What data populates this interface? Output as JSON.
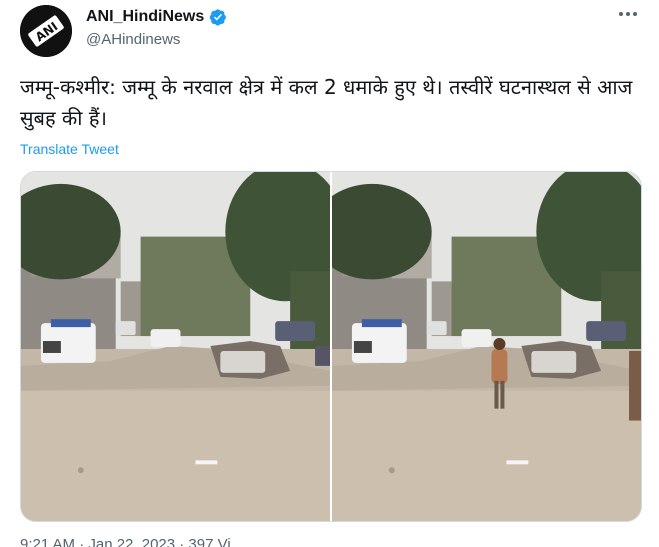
{
  "account": {
    "display_name": "ANI_HindiNews",
    "handle": "@AHindinews",
    "avatar_text": "ANI",
    "verified": true
  },
  "tweet": {
    "text": "जम्मू-कश्मीर: जम्मू के नरवाल क्षेत्र में कल 2 धमाके हुए थे। तस्वीरें घटनास्थल से आज सुबह की हैं।",
    "translate_label": "Translate Tweet",
    "timestamp_partial": "9:21 AM · Jan 22, 2023 · 397 Vi"
  },
  "media": {
    "count": 2
  },
  "colors": {
    "link": "#1d9bf0",
    "secondary_text": "#536471",
    "border": "#cfd9de",
    "verified": "#1d9bf0"
  },
  "icons": {
    "verified": "verified-badge-icon",
    "more": "more-options-icon"
  }
}
